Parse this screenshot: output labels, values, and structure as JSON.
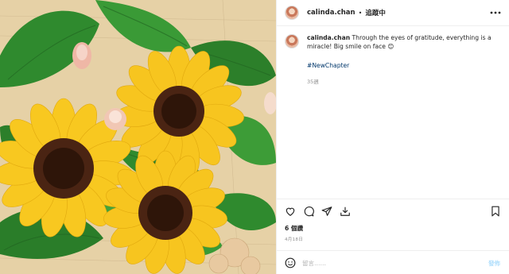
{
  "post": {
    "username": "calinda.chan",
    "separator": "•",
    "follow_label": "追蹤中",
    "caption_user": "calinda.chan",
    "caption_text": "Through the eyes of gratitude, everything is a miracle! Big smile on face 😊",
    "hashtag": "#NewChapter",
    "time_ago": "35週",
    "likes": "6 個讚",
    "date": "4月18日",
    "comment_placeholder": "留言……",
    "post_button": "發佈"
  },
  "icons": {
    "more": "more-horizontal-icon",
    "like": "heart-icon",
    "comment": "comment-bubble-icon",
    "share": "paper-plane-icon",
    "save": "bookmark-icon",
    "emoji": "emoji-smile-icon",
    "download": "download-icon"
  },
  "colors": {
    "link": "#00376b",
    "post_button": "#b2dffc",
    "sunflower_petal": "#f7c51f",
    "sunflower_center": "#4a2413",
    "leaf": "#2f8a2e"
  }
}
